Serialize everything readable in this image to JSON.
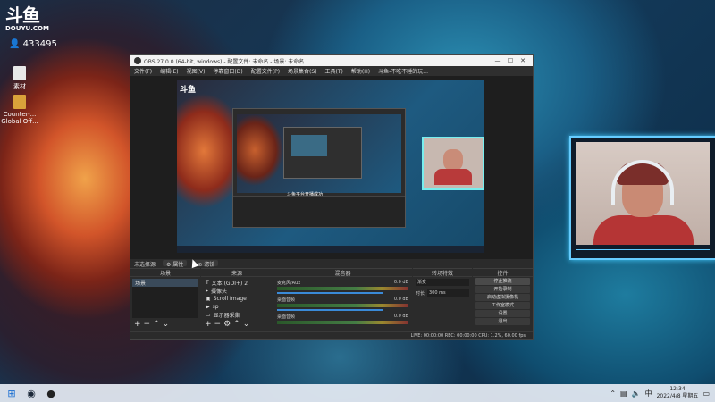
{
  "desktop": {
    "logo_mark": "斗鱼",
    "logo_sub": "DOUYU.COM",
    "room_id": "433495",
    "icons": [
      {
        "label": "素材"
      },
      {
        "label": "Counter-... Global Off..."
      }
    ]
  },
  "obs": {
    "title": "OBS 27.0.0 (64-bit, windows) - 配置文件: 未命名 - 场景: 未命名",
    "menu": [
      "文件(F)",
      "编辑(E)",
      "视图(V)",
      "停靠窗口(D)",
      "配置文件(P)",
      "场景集合(S)",
      "工具(T)",
      "帮助(H)",
      "斗鱼-不吃不睡的玩..."
    ],
    "nested_caption": "斗鱼平台开播成功",
    "source_header": "未选择源",
    "props_button": "属性",
    "filters_button": "滤镜",
    "docks": {
      "scenes": {
        "title": "场景",
        "items": [
          "场景"
        ]
      },
      "sources": {
        "title": "来源",
        "items": [
          "文本 (GDI+) 2",
          "摄像头",
          "Scroll Image",
          "sp",
          "显示器采集"
        ]
      },
      "mixer": {
        "title": "混音器",
        "tracks": [
          {
            "name": "麦克风/Aux",
            "db": "0.0 dB"
          },
          {
            "name": "桌面音频",
            "db": "0.0 dB"
          },
          {
            "name": "桌面音频",
            "db": "0.0 dB"
          }
        ]
      },
      "transitions": {
        "title": "转场特效",
        "type": "渐变",
        "duration_label": "时长",
        "duration": "300 ms"
      },
      "controls": {
        "title": "控件",
        "buttons": [
          "停止推流",
          "开始录制",
          "启动虚拟摄像机",
          "工作室模式",
          "设置",
          "退出"
        ]
      }
    },
    "status": "LIVE: 00:00:00   REC: 00:00:00   CPU: 1.2%, 60.00 fps"
  },
  "taskbar": {
    "time": "12:34",
    "date": "2022/4/8 星期五"
  }
}
